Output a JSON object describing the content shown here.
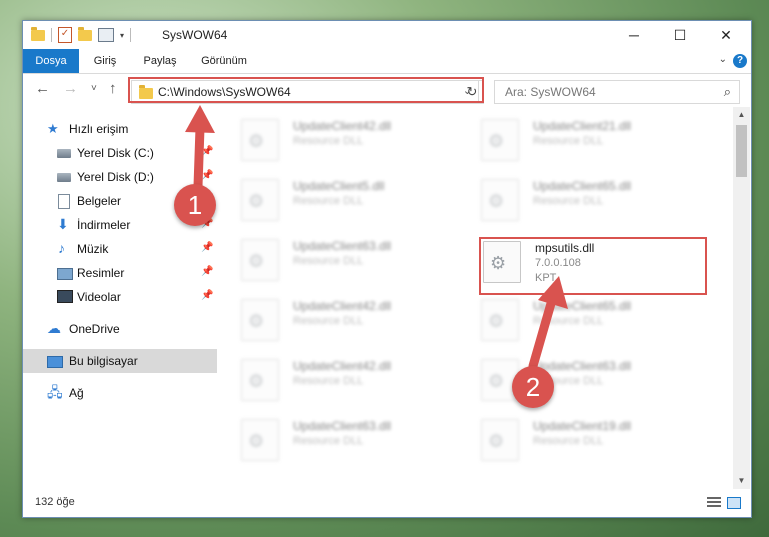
{
  "window": {
    "title": "SysWOW64",
    "controls": {
      "minimize": "─",
      "maximize": "☐",
      "close": "✕"
    }
  },
  "ribbon": {
    "tabs": [
      {
        "label": "Dosya",
        "active": true
      },
      {
        "label": "Giriş"
      },
      {
        "label": "Paylaş"
      },
      {
        "label": "Görünüm"
      }
    ],
    "help": "?"
  },
  "navigation": {
    "back": "←",
    "forward": "→",
    "recent": "˅",
    "up": "↑",
    "address": "C:\\Windows\\SysWOW64",
    "refresh": "↻",
    "search_placeholder": "Ara: SysWOW64"
  },
  "sidebar": {
    "items": [
      {
        "label": "Hızlı erişim",
        "icon": "star-icon",
        "pinned": false
      },
      {
        "label": "Yerel Disk (C:)",
        "icon": "disk-icon",
        "pinned": true
      },
      {
        "label": "Yerel Disk (D:)",
        "icon": "disk-icon",
        "pinned": true
      },
      {
        "label": "Belgeler",
        "icon": "documents-icon",
        "pinned": true
      },
      {
        "label": "İndirmeler",
        "icon": "download-icon",
        "pinned": true
      },
      {
        "label": "Müzik",
        "icon": "music-icon",
        "pinned": true
      },
      {
        "label": "Resimler",
        "icon": "pictures-icon",
        "pinned": true
      },
      {
        "label": "Videolar",
        "icon": "videos-icon",
        "pinned": true
      },
      {
        "label": "OneDrive",
        "icon": "cloud-icon",
        "pinned": false
      },
      {
        "label": "Bu bilgisayar",
        "icon": "computer-icon",
        "pinned": false,
        "selected": true
      },
      {
        "label": "Ağ",
        "icon": "network-icon",
        "pinned": false
      }
    ]
  },
  "files": {
    "blurred_items": [
      {
        "name": "UpdateClient42.dll",
        "desc": "Resource DLL"
      },
      {
        "name": "UpdateClient21.dll",
        "desc": "Resource DLL"
      },
      {
        "name": "UpdateClient5.dll",
        "desc": "Resource DLL"
      },
      {
        "name": "UpdateClient65.dll",
        "desc": "Resource DLL"
      },
      {
        "name": "UpdateClient63.dll",
        "desc": "Resource DLL"
      },
      {
        "name": "UpdateClient42.dll",
        "desc": "Resource DLL"
      },
      {
        "name": "UpdateClient65.dll",
        "desc": "Resource DLL"
      },
      {
        "name": "UpdateClient42.dll",
        "desc": "Resource DLL"
      },
      {
        "name": "UpdateClient63.dll",
        "desc": "Resource DLL"
      },
      {
        "name": "UpdateClient63.dll",
        "desc": "Resource DLL"
      },
      {
        "name": "UpdateClient19.dll",
        "desc": "Resource DLL"
      }
    ],
    "highlighted": {
      "name": "mpsutils.dll",
      "version": "7.0.0.108",
      "company": "KPT"
    }
  },
  "annotations": {
    "step1": "1",
    "step2": "2",
    "color": "#d9534f"
  },
  "status": {
    "item_count": "132 öğe"
  }
}
